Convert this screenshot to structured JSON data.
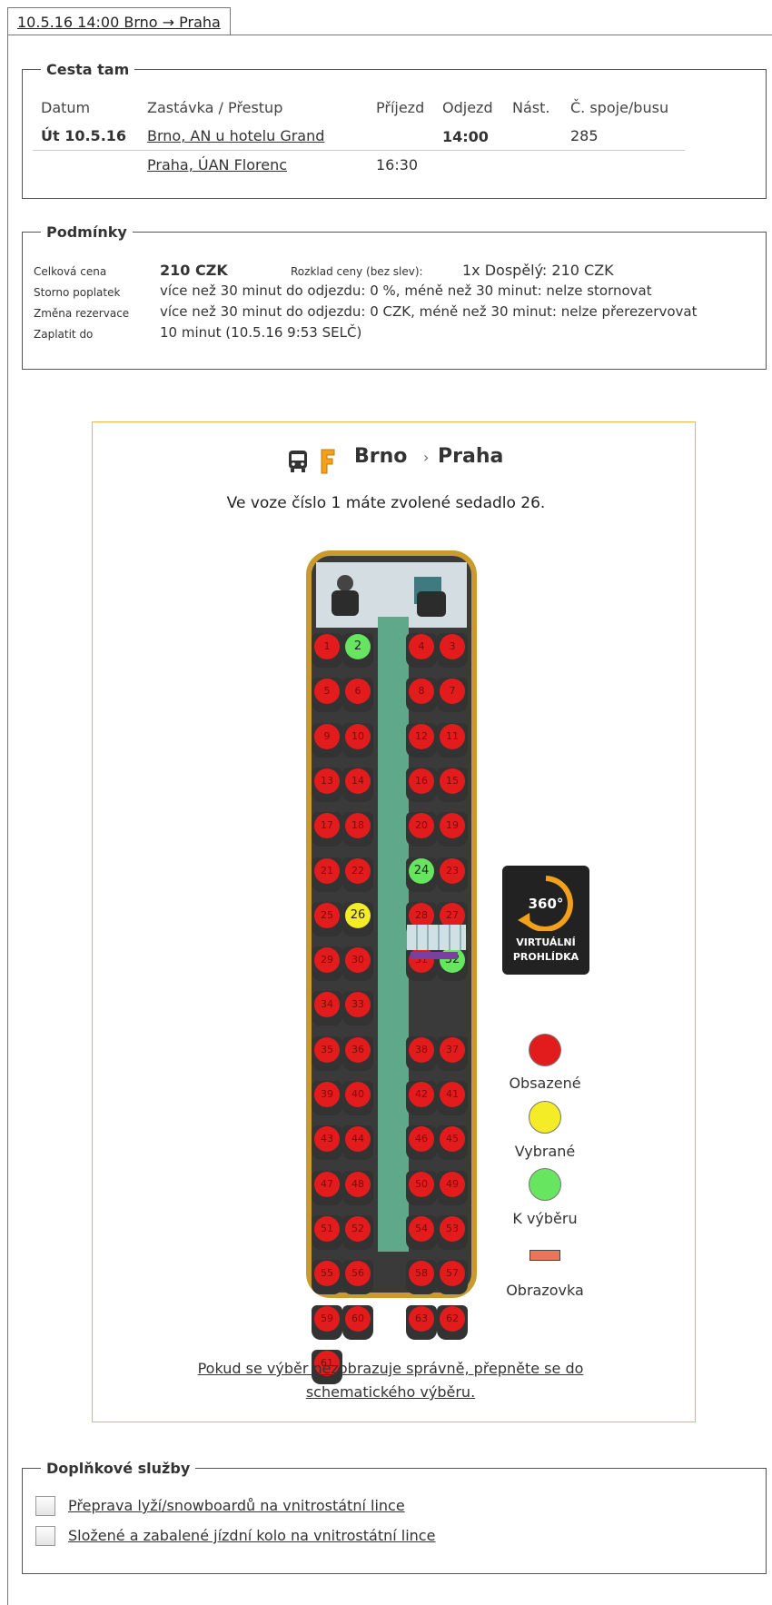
{
  "tab": {
    "title": "10.5.16 14:00 Brno → Praha"
  },
  "trip": {
    "legend": "Cesta tam",
    "headers": {
      "date": "Datum",
      "stop": "Zastávka / Přestup",
      "arrival": "Příjezd",
      "departure": "Odjezd",
      "platform": "Nást.",
      "connection": "Č. spoje/busu"
    },
    "rows": [
      {
        "date": "Út 10.5.16",
        "stop": "Brno, AN u hotelu Grand",
        "arrival": "",
        "departure": "14:00",
        "platform": "",
        "connection": "285"
      },
      {
        "date": "",
        "stop": "Praha, ÚAN Florenc",
        "arrival": "16:30",
        "departure": "",
        "platform": "",
        "connection": ""
      }
    ]
  },
  "conditions": {
    "legend": "Podmínky",
    "total_label": "Celková cena",
    "total_value": "210 CZK",
    "breakdown_label": "Rozklad ceny (bez slev):",
    "breakdown_value": "1x Dospělý: 210 CZK",
    "storno_label": "Storno poplatek",
    "storno_value": "více než 30 minut do odjezdu: 0 %, méně než 30 minut: nelze stornovat",
    "change_label": "Změna rezervace",
    "change_value": "více než 30 minut do odjezdu: 0 CZK, méně než 30 minut: nelze přerezervovat",
    "pay_label": "Zaplatit do",
    "pay_value": "10 minut (10.5.16 9:53 SELČ)"
  },
  "seatmap": {
    "from": "Brno",
    "arrow": "›",
    "to": "Praha",
    "selection_text": "Ve voze číslo 1 máte zvolené sedadlo 26.",
    "virtual_tour": {
      "badge": "360°",
      "line1": "VIRTUÁLNÍ",
      "line2": "PROHLÍDKA"
    },
    "legend": {
      "occupied": "Obsazené",
      "selected": "Vybrané",
      "available": "K výběru",
      "screen": "Obrazovka"
    },
    "colors": {
      "occupied": "#e21c1c",
      "selected": "#f3ec27",
      "available": "#67e560",
      "screen": "#e8765a",
      "aisle": "#5fa88a"
    },
    "fix_link_1": "Pokud se výběr nezobrazuje správně, přepněte se do",
    "fix_link_2": "schematického výběru.",
    "seats": [
      {
        "n": "1",
        "s": "occupied"
      },
      {
        "n": "2",
        "s": "available"
      },
      {
        "n": "4",
        "s": "occupied"
      },
      {
        "n": "3",
        "s": "occupied"
      },
      {
        "n": "5",
        "s": "occupied"
      },
      {
        "n": "6",
        "s": "occupied"
      },
      {
        "n": "8",
        "s": "occupied"
      },
      {
        "n": "7",
        "s": "occupied"
      },
      {
        "n": "9",
        "s": "occupied"
      },
      {
        "n": "10",
        "s": "occupied"
      },
      {
        "n": "12",
        "s": "occupied"
      },
      {
        "n": "11",
        "s": "occupied"
      },
      {
        "n": "13",
        "s": "occupied"
      },
      {
        "n": "14",
        "s": "occupied"
      },
      {
        "n": "16",
        "s": "occupied"
      },
      {
        "n": "15",
        "s": "occupied"
      },
      {
        "n": "17",
        "s": "occupied"
      },
      {
        "n": "18",
        "s": "occupied"
      },
      {
        "n": "20",
        "s": "occupied"
      },
      {
        "n": "19",
        "s": "occupied"
      },
      {
        "n": "21",
        "s": "occupied"
      },
      {
        "n": "22",
        "s": "occupied"
      },
      {
        "n": "24",
        "s": "available"
      },
      {
        "n": "23",
        "s": "occupied"
      },
      {
        "n": "25",
        "s": "occupied"
      },
      {
        "n": "26",
        "s": "selected"
      },
      {
        "n": "28",
        "s": "occupied"
      },
      {
        "n": "27",
        "s": "occupied"
      },
      {
        "n": "29",
        "s": "occupied"
      },
      {
        "n": "30",
        "s": "occupied"
      },
      {
        "n": "31",
        "s": "occupied"
      },
      {
        "n": "32",
        "s": "available"
      },
      {
        "n": "34",
        "s": "occupied"
      },
      {
        "n": "33",
        "s": "occupied"
      },
      {
        "n": "35",
        "s": "occupied"
      },
      {
        "n": "36",
        "s": "occupied"
      },
      {
        "n": "38",
        "s": "occupied"
      },
      {
        "n": "37",
        "s": "occupied"
      },
      {
        "n": "39",
        "s": "occupied"
      },
      {
        "n": "40",
        "s": "occupied"
      },
      {
        "n": "42",
        "s": "occupied"
      },
      {
        "n": "41",
        "s": "occupied"
      },
      {
        "n": "43",
        "s": "occupied"
      },
      {
        "n": "44",
        "s": "occupied"
      },
      {
        "n": "46",
        "s": "occupied"
      },
      {
        "n": "45",
        "s": "occupied"
      },
      {
        "n": "47",
        "s": "occupied"
      },
      {
        "n": "48",
        "s": "occupied"
      },
      {
        "n": "50",
        "s": "occupied"
      },
      {
        "n": "49",
        "s": "occupied"
      },
      {
        "n": "51",
        "s": "occupied"
      },
      {
        "n": "52",
        "s": "occupied"
      },
      {
        "n": "54",
        "s": "occupied"
      },
      {
        "n": "53",
        "s": "occupied"
      },
      {
        "n": "55",
        "s": "occupied"
      },
      {
        "n": "56",
        "s": "occupied"
      },
      {
        "n": "58",
        "s": "occupied"
      },
      {
        "n": "57",
        "s": "occupied"
      },
      {
        "n": "59",
        "s": "occupied"
      },
      {
        "n": "60",
        "s": "occupied"
      },
      {
        "n": "63",
        "s": "occupied"
      },
      {
        "n": "62",
        "s": "occupied"
      },
      {
        "n": "61",
        "s": "occupied"
      }
    ]
  },
  "extras": {
    "legend": "Doplňkové služby",
    "items": [
      {
        "label": "Přeprava lyží/snowboardů na vnitrostátní lince",
        "checked": false
      },
      {
        "label": "Složené a zabalené jízdní kolo na vnitrostátní lince",
        "checked": false
      }
    ]
  }
}
